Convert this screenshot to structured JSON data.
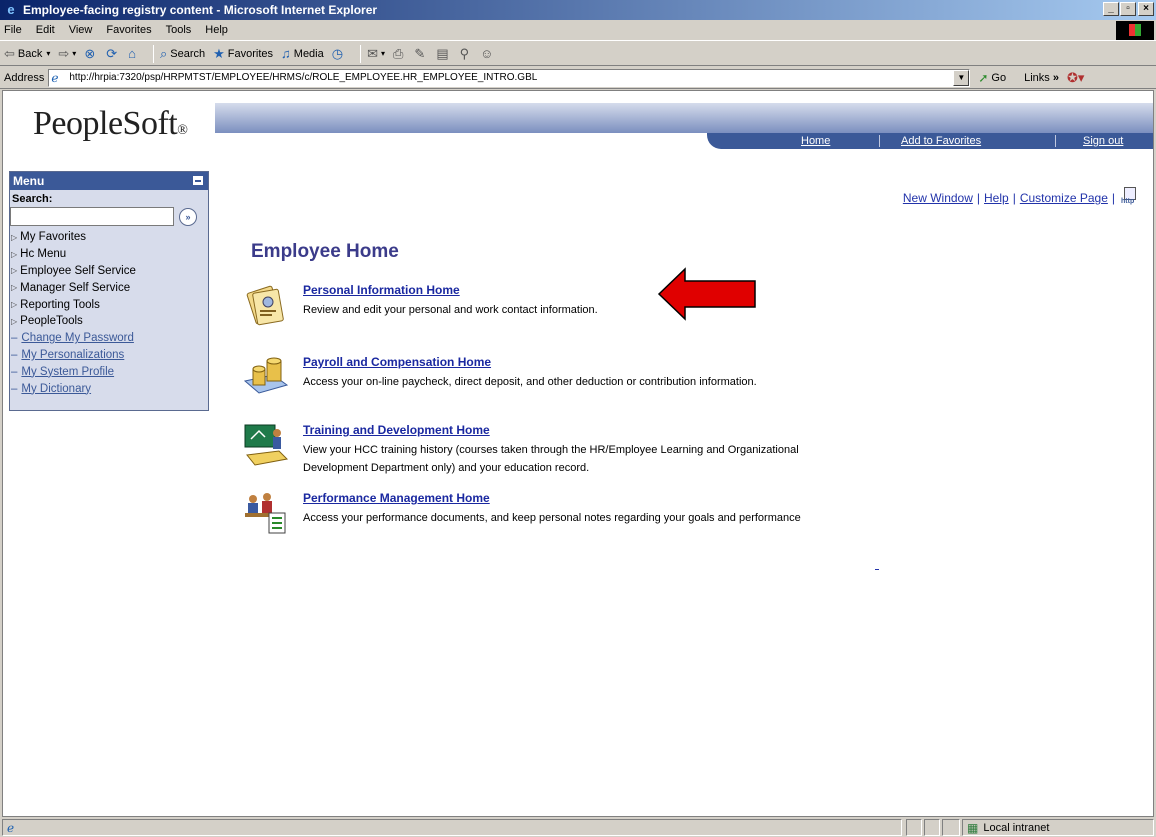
{
  "window": {
    "title": "Employee-facing registry content - Microsoft Internet Explorer"
  },
  "menubar": [
    "File",
    "Edit",
    "View",
    "Favorites",
    "Tools",
    "Help"
  ],
  "toolbar": {
    "back": "Back",
    "search": "Search",
    "favorites": "Favorites",
    "media": "Media"
  },
  "address": {
    "label": "Address",
    "url": "http://hrpia:7320/psp/HRPMTST/EMPLOYEE/HRMS/c/ROLE_EMPLOYEE.HR_EMPLOYEE_INTRO.GBL",
    "go": "Go",
    "links": "Links"
  },
  "header": {
    "logo": "PeopleSoft",
    "nav": [
      "Home",
      "Add to Favorites",
      "Sign out"
    ]
  },
  "menu": {
    "title": "Menu",
    "search_label": "Search:",
    "search_value": "",
    "folders": [
      "My Favorites",
      "Hc Menu",
      "Employee Self Service",
      "Manager Self Service",
      "Reporting Tools",
      "PeopleTools"
    ],
    "links": [
      "Change My Password",
      "My Personalizations",
      "My System Profile",
      "My Dictionary"
    ]
  },
  "pagelinks": [
    "New Window",
    "Help",
    "Customize Page"
  ],
  "http_icon_label": "http",
  "main": {
    "title": "Employee Home",
    "entries": [
      {
        "title": "Personal Information Home",
        "desc": "Review and edit your personal and work contact information."
      },
      {
        "title": "Payroll and Compensation Home",
        "desc": "Access your on-line paycheck, direct deposit, and other deduction or contribution information."
      },
      {
        "title": "Training and Development Home",
        "desc": "View your HCC training history (courses taken through the HR/Employee Learning and Organizational Development Department only) and your education record."
      },
      {
        "title": "Performance Management Home",
        "desc": "Access your performance documents, and keep personal notes regarding your goals and performance"
      }
    ]
  },
  "status": {
    "zone": "Local intranet"
  },
  "colors": {
    "accent": "#3b5998",
    "link": "#1a28a0",
    "arrow": "#e00000"
  }
}
